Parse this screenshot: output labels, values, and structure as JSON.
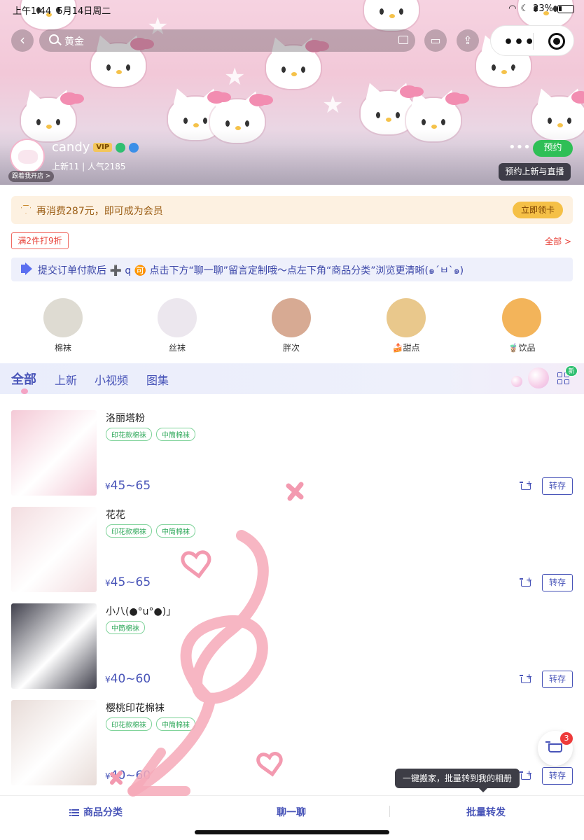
{
  "status_bar": {
    "time": "上午1:44",
    "date": "5月14日周二",
    "battery": "23%"
  },
  "search": {
    "placeholder": "黄金"
  },
  "shop": {
    "name": "candy",
    "vip": "VIP",
    "stats": "上新11 | 人气2185",
    "follow_tag": "跟着我开店 >",
    "more": "•••",
    "reserve_button": "预约",
    "reserve_tip": "预约上新与直播"
  },
  "member": {
    "text": "再消费287元，即可成为会员",
    "claim_button": "立即领卡"
  },
  "promo": {
    "discount_tag": "满2件打9折",
    "all_link": "全部 >"
  },
  "notice": {
    "text": "提交订单付款后 ➕ q 🉑 点击下方“聊一聊”留言定制哦～点左下角“商品分类”浏览更清晰(๑´ㅂ`๑)"
  },
  "categories": [
    {
      "label": "棉袜",
      "color": "#dedbd2"
    },
    {
      "label": "丝袜",
      "color": "#ece7ee"
    },
    {
      "label": "胖次",
      "color": "#d7aa93"
    },
    {
      "label": "🍰甜点",
      "color": "#e9c88c"
    },
    {
      "label": "🧋饮品",
      "color": "#f3b45a"
    }
  ],
  "tabs": [
    "全部",
    "上新",
    "小视频",
    "图集"
  ],
  "new_badge": "新",
  "products": [
    {
      "name": "洛丽塔粉",
      "tags": [
        "印花款棉袜",
        "中筒棉袜"
      ],
      "price_symbol": "¥",
      "price": "45~65",
      "save": "转存",
      "color": "#f4c9d6"
    },
    {
      "name": "花花",
      "tags": [
        "印花款棉袜",
        "中筒棉袜"
      ],
      "price_symbol": "¥",
      "price": "45~65",
      "save": "转存",
      "color": "#f3dde0"
    },
    {
      "name": "小八(●°u°●)」",
      "tags": [
        "中筒棉袜"
      ],
      "price_symbol": "¥",
      "price": "40~60",
      "save": "转存",
      "color": "#40404c"
    },
    {
      "name": "樱桃印花棉袜",
      "tags": [
        "印花款棉袜",
        "中筒棉袜"
      ],
      "price_symbol": "¥",
      "price": "40~60",
      "save": "转存",
      "color": "#e8dcd8"
    }
  ],
  "cart": {
    "count": "3"
  },
  "bulk_tip": "一键搬家，批量转到我的相册",
  "bottom_bar": {
    "category": "商品分类",
    "chat": "聊一聊",
    "bulk": "批量转发"
  },
  "accent_color": "#4854b8"
}
